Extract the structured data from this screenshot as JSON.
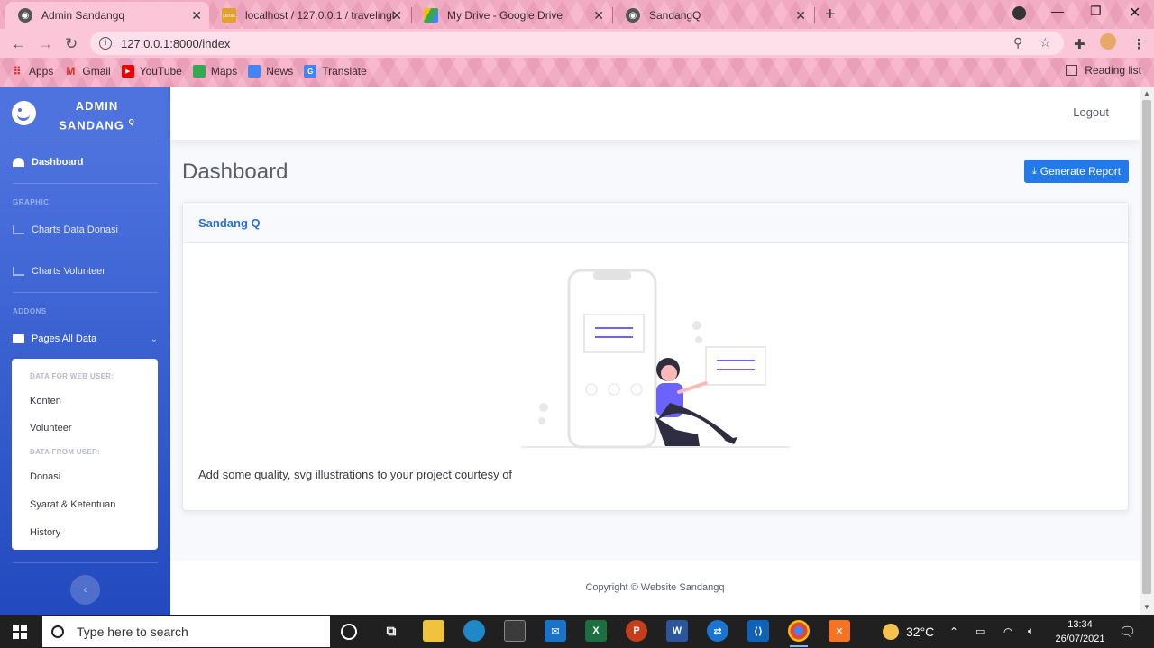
{
  "browser": {
    "tabs": [
      {
        "label": "Admin Sandangq",
        "active": true
      },
      {
        "label": "localhost / 127.0.0.1 / travelingku",
        "active": false
      },
      {
        "label": "My Drive - Google Drive",
        "active": false
      },
      {
        "label": "SandangQ",
        "active": false
      }
    ],
    "url": "127.0.0.1:8000/index",
    "bookmarks": [
      "Apps",
      "Gmail",
      "YouTube",
      "Maps",
      "News",
      "Translate"
    ],
    "reading_list": "Reading list"
  },
  "sidebar": {
    "brand_line1": "ADMIN",
    "brand_line2": "SANDANG",
    "brand_sup": "Q",
    "dashboard": "Dashboard",
    "heading_graphic": "GRAPHIC",
    "charts_donasi": "Charts Data Donasi",
    "charts_volunteer": "Charts Volunteer",
    "heading_addons": "ADDONS",
    "pages_all_data": "Pages All Data",
    "submenu": {
      "head_web_user": "DATA FOR WEB USER:",
      "konten": "Konten",
      "volunteer": "Volunteer",
      "head_from_user": "DATA FROM USER:",
      "donasi": "Donasi",
      "syarat": "Syarat & Ketentuan",
      "history": "History"
    }
  },
  "topbar": {
    "logout": "Logout"
  },
  "main": {
    "title": "Dashboard",
    "generate_report": "Generate Report",
    "card_title": "Sandang Q",
    "card_text": "Add some quality, svg illustrations to your project courtesy of"
  },
  "footer": {
    "copyright": "Copyright © Website Sandangq"
  },
  "taskbar": {
    "search_placeholder": "Type here to search",
    "temperature": "32°C",
    "time": "13:34",
    "date": "26/07/2021"
  },
  "colors": {
    "sidebar_start": "#4e73df",
    "sidebar_end": "#224abe",
    "chrome_pink": "#f7a9c3",
    "button_blue": "#2479e8"
  }
}
